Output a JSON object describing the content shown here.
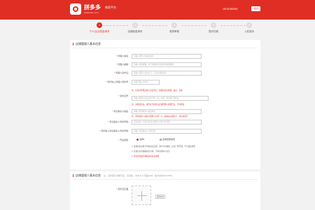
{
  "header": {
    "brand_name": "拼多多",
    "brand_sub": "pinduoduo.com",
    "title": "商家平台",
    "phone": "15701590093",
    "logout_label": "退出"
  },
  "steps": [
    {
      "num": "1",
      "label": "个人/企业信息填写",
      "active": true
    },
    {
      "num": "2",
      "label": "店铺信息填写",
      "active": false
    },
    {
      "num": "3",
      "label": "资质审核",
      "active": false
    },
    {
      "num": "4",
      "label": "签约付款",
      "active": false
    },
    {
      "num": "5",
      "label": "入驻成功",
      "active": false
    }
  ],
  "section1": {
    "title": "店铺管理人基本信息",
    "fields": {
      "name": {
        "label": "管理人姓名:",
        "placeholder": "请输入管理人的真实姓名"
      },
      "email": {
        "label": "管理人邮箱:",
        "placeholder": "请输入常用邮箱，用于接收拼多多发布的重要通知"
      },
      "id_number": {
        "label": "管理人身份证:",
        "placeholder": "请输入管理人身份证号，不支持其他证件"
      },
      "mobile": {
        "label": "同步输入管理人手机号:",
        "placeholder": "请填写输入手机号"
      },
      "id_card": {
        "label": "身份证号:",
        "placeholder": "请输入管理人身份证件号码，如：护照、香港澳门通行证"
      },
      "emergency_name": {
        "label": "紧急联系人姓名:",
        "placeholder": "请输入紧急联系人真实姓名"
      },
      "emergency_phone": {
        "label": "紧急联系人手机号码:",
        "placeholder": "紧急联系人手机号码请与管理人手机号码不同"
      },
      "emergency_mobile": {
        "label": "同步输入紧急联系人手机号码:",
        "placeholder": "请输入紧急联系人手机号码"
      },
      "agreement": {
        "label": "开设类型:"
      }
    },
    "warnings": {
      "w1": "注：仅支持管理员本人实名登记，请保持信息准确、真实，有效",
      "w2": "注：审核通过后，身份证号将作为店铺管理人重要凭证，不可修改",
      "w3": "注：紧急联系人请勿与管理人为同一人，此事关店铺安全，请认真填写"
    },
    "radios": {
      "opt1": "选择1",
      "opt2": "选择结果类型"
    },
    "notes": {
      "n1": "1. 每笔拼多多账号均需真实注册，遵守平台规则，店铺一经开通，不可更改类型",
      "n2": "2. 店铺信息请确保真实有效，不得冒用他人信息",
      "n3": "3. 若有任何疑问请联系拼多多客服"
    }
  },
  "section2": {
    "title": "店铺管理人基本信息",
    "note": "注：证件照片清晰可见，无遮挡，文件大小不超过5M，格式支持JPG/PNG",
    "upload_label": "身份证正面:",
    "upload_button": "选择文件"
  },
  "colors": {
    "brand": "#e02e24",
    "page_bg": "#f2f2f2"
  }
}
